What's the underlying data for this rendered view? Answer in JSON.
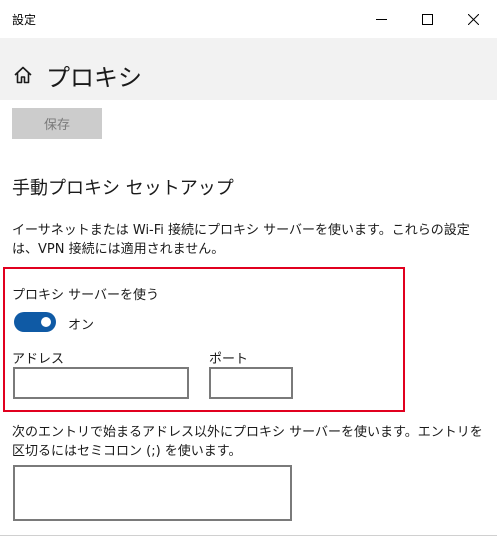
{
  "window": {
    "title": "設定",
    "controls": [
      "minimize-icon",
      "maximize-icon",
      "close-icon"
    ]
  },
  "header": {
    "icon": "home-icon",
    "title": "プロキシ"
  },
  "save_button": {
    "label": "保存",
    "enabled": false
  },
  "manual_proxy": {
    "heading": "手動プロキシ セットアップ",
    "description": "イーサネットまたは Wi-Fi 接続にプロキシ サーバーを使います。これらの設定は、VPN 接続には適用されません。",
    "use_proxy": {
      "label": "プロキシ サーバーを使う",
      "toggle_on": true,
      "state_text": "オン"
    },
    "address": {
      "label": "アドレス",
      "value": ""
    },
    "port": {
      "label": "ポート",
      "value": ""
    },
    "exceptions": {
      "description": "次のエントリで始まるアドレス以外にプロキシ サーバーを使います。エントリを区切るにはセミコロン (;) を使います。",
      "value": ""
    }
  },
  "colors": {
    "accent": "#0f5aa5",
    "highlight": "#e1001f",
    "header_bg": "#f2f2f2",
    "button_disabled": "#cccccc"
  }
}
